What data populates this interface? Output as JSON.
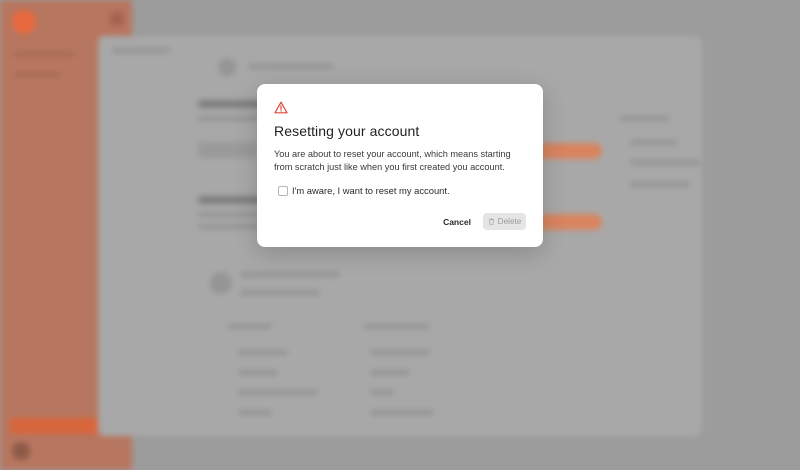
{
  "modal": {
    "icon": "warning-triangle-icon",
    "title": "Resetting your account",
    "body": "You are about to reset your account, which means starting from scratch just like when you first created you account.",
    "confirm_label": "I'm aware, I want to reset my account.",
    "confirm_checked": false,
    "cancel_label": "Cancel",
    "delete_label": "Delete",
    "delete_icon": "trash-icon",
    "delete_enabled": false
  },
  "colors": {
    "warning": "#e0453a",
    "accent": "#e8693d",
    "overlay": "#9c9c9c"
  }
}
